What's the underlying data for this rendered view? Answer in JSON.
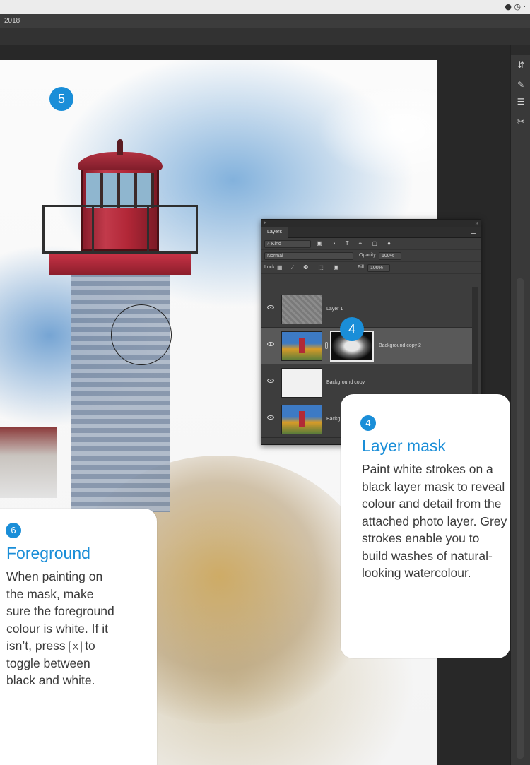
{
  "app": {
    "title_fragment": "2018"
  },
  "canvas": {
    "badge_5": "5"
  },
  "layers_panel": {
    "tab": "Layers",
    "filter_kind": "⌕ Kind",
    "blend_mode": "Normal",
    "opacity_label": "Opacity:",
    "opacity_value": "100%",
    "lock_label": "Lock:",
    "fill_label": "Fill:",
    "fill_value": "100%",
    "filter_icons": "▣ ◑ T ⌖ ▢ ●",
    "lock_icons": "▦ ∕ ✠ ⬚ ▣",
    "layers": [
      {
        "name": "Layer 1",
        "thumbnail": "gray-noise",
        "visible": true,
        "selected": false
      },
      {
        "name": "Background copy 2",
        "thumbnail": "photo",
        "mask": true,
        "visible": true,
        "selected": true
      },
      {
        "name": "Background copy",
        "thumbnail": "sketch",
        "visible": true,
        "selected": false
      },
      {
        "name": "Backg",
        "thumbnail": "photo",
        "visible": true,
        "selected": false
      }
    ],
    "badge_4": "4"
  },
  "callouts": {
    "layer_mask": {
      "number": "4",
      "title": "Layer mask",
      "body": "Paint white strokes on a black layer mask to reveal colour and detail from the attached photo layer. Grey strokes enable you to build washes of natural-looking watercolour."
    },
    "foreground": {
      "number": "6",
      "title": "Foreground",
      "body_before_key": "When painting on the mask, make sure the foreground colour is white. If it isn’t, press",
      "key": "X",
      "body_after_key": "to toggle between black and white."
    }
  },
  "colors": {
    "accent": "#1a8ed8",
    "panel": "#3d3d3d",
    "selected_layer": "#595959"
  }
}
